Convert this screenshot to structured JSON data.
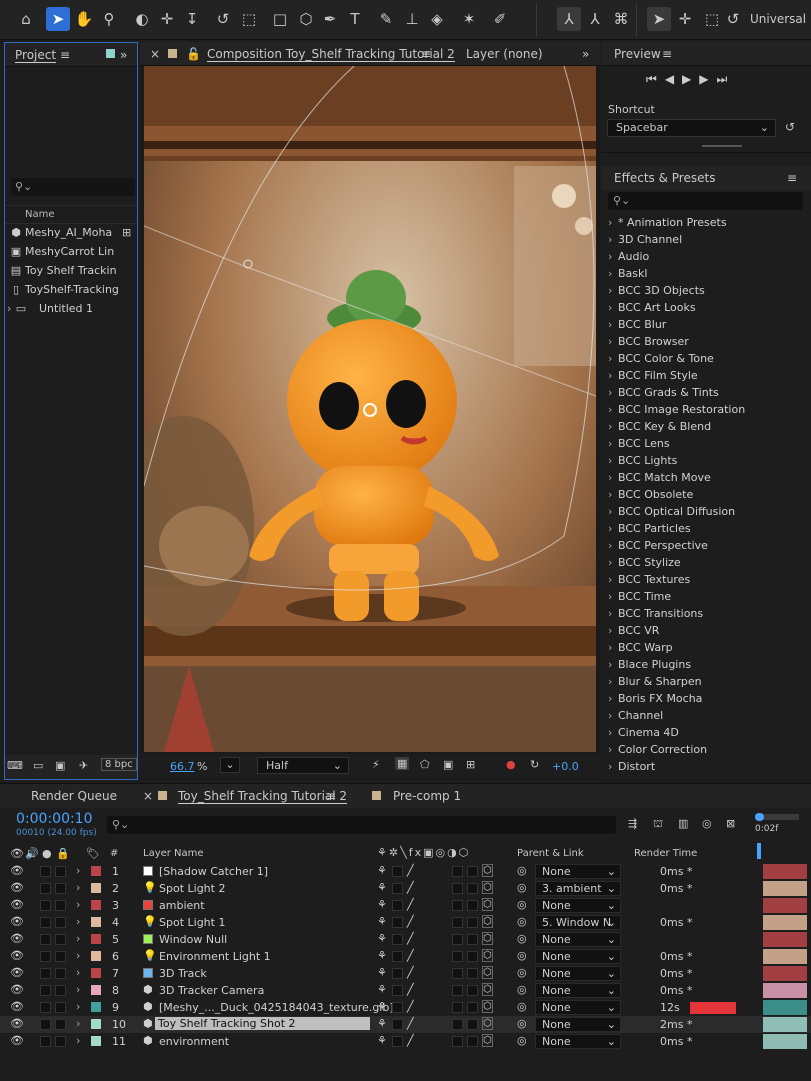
{
  "toolbar": {
    "workspace": "Universal",
    "tools": [
      "home-icon",
      "selection-icon",
      "hand-icon",
      "zoom-icon",
      "orbit-icon",
      "pan-icon",
      "dolly-icon",
      "rotate-icon",
      "pan-behind-icon",
      "rectangle-icon",
      "cube-icon",
      "pen-icon",
      "type-icon",
      "brush-icon",
      "clone-stamp-icon",
      "eraser-icon",
      "roto-brush-icon",
      "puppet-pin-icon"
    ]
  },
  "project": {
    "title": "Project",
    "column_name": "Name",
    "items": [
      {
        "label": "Meshy_AI_Moha",
        "icon": "model-icon"
      },
      {
        "label": "MeshyCarrot Lin",
        "icon": "footage-icon"
      },
      {
        "label": "Toy Shelf Trackin",
        "icon": "composition-icon"
      },
      {
        "label": "ToyShelf-Tracking",
        "icon": "file-icon"
      },
      {
        "label": "Untitled 1",
        "icon": "folder-icon"
      }
    ],
    "bpc": "8 bpc"
  },
  "comp": {
    "tab_label": "Composition Toy_Shelf Tracking Tutorial 2",
    "layer_tab": "Layer (none)",
    "zoom": "66.7",
    "zoom_unit": "%",
    "resolution": "Half",
    "exposure": "+0.0"
  },
  "preview": {
    "title": "Preview",
    "shortcut_label": "Shortcut",
    "shortcut_value": "Spacebar"
  },
  "effects": {
    "title": "Effects & Presets",
    "items": [
      "* Animation Presets",
      "3D Channel",
      "Audio",
      "Baskl",
      "BCC 3D Objects",
      "BCC Art Looks",
      "BCC Blur",
      "BCC Browser",
      "BCC Color & Tone",
      "BCC Film Style",
      "BCC Grads & Tints",
      "BCC Image Restoration",
      "BCC Key & Blend",
      "BCC Lens",
      "BCC Lights",
      "BCC Match Move",
      "BCC Obsolete",
      "BCC Optical Diffusion",
      "BCC Particles",
      "BCC Perspective",
      "BCC Stylize",
      "BCC Textures",
      "BCC Time",
      "BCC Transitions",
      "BCC VR",
      "BCC Warp",
      "Blace Plugins",
      "Blur & Sharpen",
      "Boris FX Mocha",
      "Channel",
      "Cinema 4D",
      "Color Correction",
      "Distort"
    ]
  },
  "timeline": {
    "tabs": [
      "Render Queue",
      "Toy_Shelf Tracking Tutorial 2",
      "Pre-comp 1"
    ],
    "timecode": "0:00:00:10",
    "frame_info": "00010 (24.00 fps)",
    "ruler_label": "0:02f",
    "columns": {
      "num": "#",
      "layer_name": "Layer Name",
      "parent": "Parent & Link",
      "render_time": "Render Time"
    },
    "layers": [
      {
        "num": "1",
        "name": "[Shadow Catcher 1]",
        "color": "#b8454a",
        "swatch": "#ffffff",
        "parent": "None",
        "render": "0ms *"
      },
      {
        "num": "2",
        "name": "Spot Light 2",
        "color": "#e0b99c",
        "swatch": "",
        "parent": "3. ambient",
        "render": "0ms *"
      },
      {
        "num": "3",
        "name": "ambient",
        "color": "#b8454a",
        "swatch": "#e8443c",
        "parent": "None",
        "render": ""
      },
      {
        "num": "4",
        "name": "Spot Light 1",
        "color": "#e0b99c",
        "swatch": "",
        "parent": "5. Window N",
        "render": "0ms *"
      },
      {
        "num": "5",
        "name": "Window Null",
        "color": "#b8454a",
        "swatch": "#9ef05a",
        "parent": "None",
        "render": ""
      },
      {
        "num": "6",
        "name": "Environment Light 1",
        "color": "#e0b99c",
        "swatch": "",
        "parent": "None",
        "render": "0ms *"
      },
      {
        "num": "7",
        "name": "3D Track",
        "color": "#b8454a",
        "swatch": "#6ab5f0",
        "parent": "None",
        "render": "0ms *"
      },
      {
        "num": "8",
        "name": "3D Tracker Camera",
        "color": "#e6a6c0",
        "swatch": "",
        "parent": "None",
        "render": "0ms *"
      },
      {
        "num": "9",
        "name": "[Meshy_..._Duck_0425184043_texture.glb]",
        "color": "#3fa19c",
        "swatch": "",
        "parent": "None",
        "render": "12s"
      },
      {
        "num": "10",
        "name": "Toy Shelf Tracking Shot 2",
        "color": "#a3d8cc",
        "swatch": "",
        "parent": "None",
        "render": "2ms *"
      },
      {
        "num": "11",
        "name": "environment",
        "color": "#a3d8cc",
        "swatch": "",
        "parent": "None",
        "render": "0ms *"
      }
    ]
  }
}
